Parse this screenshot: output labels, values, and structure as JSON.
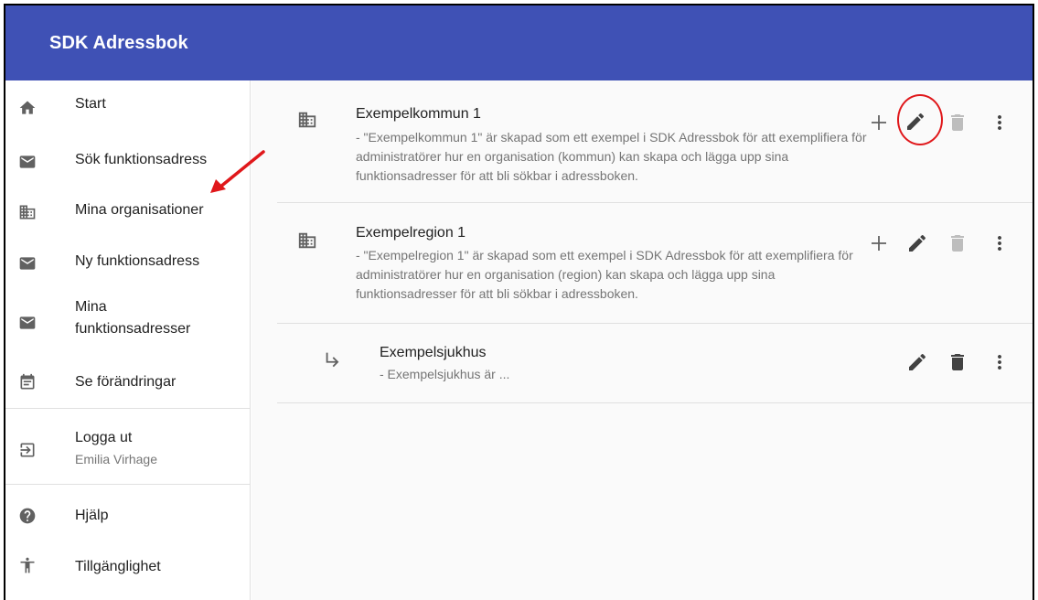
{
  "app": {
    "title": "SDK Adressbok"
  },
  "sidebar": {
    "items": [
      {
        "label": "Start",
        "icon": "home-icon"
      },
      {
        "label": "Sök funktionsadress",
        "icon": "mail-icon"
      },
      {
        "label": "Mina organisationer",
        "icon": "building-icon"
      },
      {
        "label": "Ny funktionsadress",
        "icon": "mail-icon"
      },
      {
        "label": "Mina funktionsadresser",
        "icon": "mail-icon"
      },
      {
        "label": "Se förändringar",
        "icon": "event-note-icon"
      },
      {
        "label": "Logga ut",
        "sub": "Emilia Virhage",
        "icon": "logout-icon"
      },
      {
        "label": "Hjälp",
        "icon": "help-icon"
      },
      {
        "label": "Tillgänglighet",
        "icon": "accessibility-icon"
      }
    ]
  },
  "organisations": [
    {
      "name": "Exempelkommun 1",
      "description": " - \"Exempelkommun 1\" är skapad som ett exempel i SDK Adressbok för att exemplifiera för administratörer hur en organisation (kommun) kan skapa och lägga upp sina funktionsadresser för att bli sökbar i adressboken.",
      "icon": "building-icon",
      "actions": [
        "add-icon",
        "edit-icon",
        "delete-icon",
        "more-vert-icon"
      ]
    },
    {
      "name": "Exempelregion 1",
      "description": " - \"Exempelregion 1\" är skapad som ett exempel i SDK Adressbok för att exemplifiera för administratörer hur en organisation (region) kan skapa och lägga upp sina funktionsadresser för att bli sökbar i adressboken.",
      "icon": "building-icon",
      "actions": [
        "add-icon",
        "edit-icon",
        "delete-icon",
        "more-vert-icon"
      ]
    },
    {
      "name": "Exempelsjukhus",
      "description": " - Exempelsjukhus är ...",
      "icon": "subdirectory-arrow-icon",
      "actions": [
        "edit-icon",
        "delete-icon",
        "more-vert-icon"
      ]
    }
  ],
  "colors": {
    "appbar": "#3f51b5",
    "icon": "#616161",
    "disabled_icon": "#bdbdbd",
    "annotation": "#e0181b"
  }
}
